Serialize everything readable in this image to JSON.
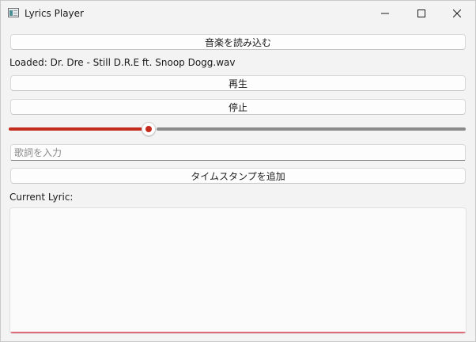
{
  "window": {
    "title": "Lyrics Player",
    "app_icon": "app-window-icon",
    "controls": [
      "minimize-icon",
      "maximize-icon",
      "close-icon"
    ]
  },
  "main": {
    "load_button_label": "音楽を読み込む",
    "loaded_status": "Loaded: Dr. Dre - Still D.R.E ft. Snoop Dogg.wav",
    "play_button_label": "再生",
    "stop_button_label": "停止",
    "progress": {
      "value_percent": 30.6,
      "accent_color": "#c42b1c",
      "rest_color": "#8a8a8a"
    },
    "lyric_input": {
      "placeholder": "歌詞を入力",
      "value": ""
    },
    "add_timestamp_button_label": "タイムスタンプを追加",
    "current_lyric_label": "Current Lyric:",
    "current_lyric_text": "",
    "current_lyric_accent_color": "#e06b78"
  }
}
